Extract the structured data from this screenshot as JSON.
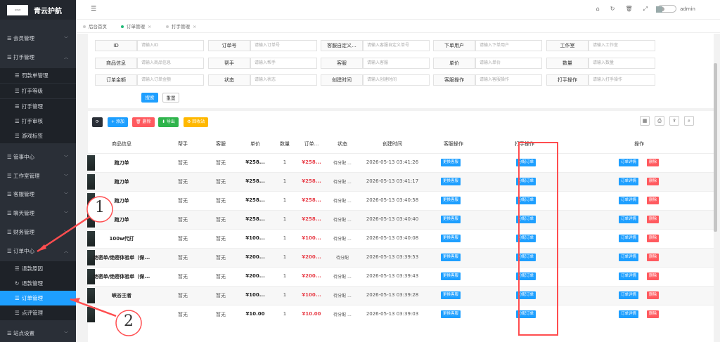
{
  "app": {
    "title": "青云护航",
    "logo_text": "LOGO"
  },
  "sidebar": {
    "items": [
      {
        "label": "会员管理",
        "icon": "list-icon",
        "type": "group",
        "expanded": false
      },
      {
        "label": "打手管理",
        "icon": "list-icon",
        "type": "group",
        "expanded": true
      },
      {
        "label": "罚款单管理",
        "icon": "list-icon",
        "type": "sub"
      },
      {
        "label": "打手等级",
        "icon": "list-icon",
        "type": "sub"
      },
      {
        "label": "打手管理",
        "icon": "list-icon",
        "type": "sub"
      },
      {
        "label": "打手审核",
        "icon": "list-icon",
        "type": "sub"
      },
      {
        "label": "游戏标签",
        "icon": "list-icon",
        "type": "sub"
      },
      {
        "label": "管事中心",
        "icon": "list-icon",
        "type": "group",
        "expanded": false
      },
      {
        "label": "工作室管理",
        "icon": "list-icon",
        "type": "group",
        "expanded": false
      },
      {
        "label": "客服管理",
        "icon": "list-icon",
        "type": "group",
        "expanded": false
      },
      {
        "label": "聊天管理",
        "icon": "list-icon",
        "type": "group",
        "expanded": false
      },
      {
        "label": "财务管理",
        "icon": "list-icon",
        "type": "group",
        "expanded": false
      },
      {
        "label": "订单中心",
        "icon": "list-icon",
        "type": "group",
        "expanded": true
      },
      {
        "label": "退款原因",
        "icon": "list-icon",
        "type": "sub"
      },
      {
        "label": "退款管理",
        "icon": "refresh-icon",
        "type": "sub"
      },
      {
        "label": "订单管理",
        "icon": "list-icon",
        "type": "sub",
        "active": true
      },
      {
        "label": "点评管理",
        "icon": "list-icon",
        "type": "sub"
      },
      {
        "label": "站点设置",
        "icon": "list-icon",
        "type": "group",
        "expanded": false
      }
    ]
  },
  "header": {
    "icons": [
      "home-icon",
      "refresh-icon",
      "trash-icon",
      "fullscreen-icon",
      "theme-toggle",
      "avatar"
    ],
    "user": "admin"
  },
  "tabs": [
    {
      "label": "后台首页",
      "active": false,
      "closable": false
    },
    {
      "label": "订单管理",
      "active": true,
      "closable": true
    },
    {
      "label": "打手管理",
      "active": false,
      "closable": true
    }
  ],
  "filters": [
    {
      "label": "ID",
      "placeholder": "请输入ID"
    },
    {
      "label": "订单号",
      "placeholder": "请输入订单号"
    },
    {
      "label": "客服自定义...",
      "placeholder": "请输入客服自定义单号"
    },
    {
      "label": "下单用户",
      "placeholder": "请输入下单用户"
    },
    {
      "label": "工作室",
      "placeholder": "请输入工作室"
    },
    {
      "label": "商品信息",
      "placeholder": "请输入商品信息"
    },
    {
      "label": "帮手",
      "placeholder": "请输入帮手"
    },
    {
      "label": "客服",
      "placeholder": "请输入客服"
    },
    {
      "label": "单价",
      "placeholder": "请输入单价"
    },
    {
      "label": "数量",
      "placeholder": "请输入数量"
    },
    {
      "label": "订单金额",
      "placeholder": "请输入订单金额"
    },
    {
      "label": "状态",
      "placeholder": "请输入状态"
    },
    {
      "label": "创建时间",
      "placeholder": "请输入创建时间"
    },
    {
      "label": "客服操作",
      "placeholder": "请输入客服操作"
    },
    {
      "label": "打手操作",
      "placeholder": "请输入打手操作"
    }
  ],
  "search_button": "搜索",
  "reset_button": "重置",
  "toolbar": {
    "refresh": "⟳",
    "add": "+ 添加",
    "delete": "🗑 删除",
    "export": "⬇ 导出",
    "recycle": "♻ 回收站"
  },
  "toolbar_right_icons": [
    "columns-icon",
    "print-icon",
    "export-icon",
    "search-icon"
  ],
  "table": {
    "columns": [
      "商品信息",
      "帮手",
      "客服",
      "单价",
      "数量",
      "订单...",
      "状态",
      "创建时间",
      "客服操作",
      "打手操作",
      "操作"
    ],
    "rows": [
      {
        "name": "跑刀单",
        "helper": "暂无",
        "service": "暂无",
        "price": "¥258...",
        "qty": "1",
        "amount": "¥258...",
        "status": "待分配 ...",
        "time": "2026-05-13 03:41:26"
      },
      {
        "name": "跑刀单",
        "helper": "暂无",
        "service": "暂无",
        "price": "¥258...",
        "qty": "1",
        "amount": "¥258...",
        "status": "待分配 ...",
        "time": "2026-05-13 03:41:17"
      },
      {
        "name": "跑刀单",
        "helper": "暂无",
        "service": "暂无",
        "price": "¥258...",
        "qty": "1",
        "amount": "¥258...",
        "status": "待分配 ...",
        "time": "2026-05-13 03:40:58"
      },
      {
        "name": "跑刀单",
        "helper": "暂无",
        "service": "暂无",
        "price": "¥258...",
        "qty": "1",
        "amount": "¥258...",
        "status": "待分配 ...",
        "time": "2026-05-13 03:40:40"
      },
      {
        "name": "100w代打",
        "helper": "暂无",
        "service": "暂无",
        "price": "¥100...",
        "qty": "1",
        "amount": "¥100...",
        "status": "待分配 ...",
        "time": "2026-05-13 03:40:08"
      },
      {
        "name": "绝密单/绝密体验单（保...",
        "helper": "暂无",
        "service": "暂无",
        "price": "¥200...",
        "qty": "1",
        "amount": "¥200...",
        "status": "待分配",
        "time": "2026-05-13 03:39:53"
      },
      {
        "name": "绝密单/绝密体验单（保...",
        "helper": "暂无",
        "service": "暂无",
        "price": "¥200...",
        "qty": "1",
        "amount": "¥200...",
        "status": "待分配 ...",
        "time": "2026-05-13 03:39:43"
      },
      {
        "name": "峡谷王者",
        "helper": "暂无",
        "service": "暂无",
        "price": "¥100...",
        "qty": "1",
        "amount": "¥100...",
        "status": "待分配 ...",
        "time": "2026-05-13 03:39:28"
      },
      {
        "name": "",
        "helper": "暂无",
        "service": "暂无",
        "price": "¥10.00",
        "qty": "1",
        "amount": "¥10.00",
        "status": "待分配 ...",
        "time": "2026-05-13 03:39:03"
      }
    ],
    "actions": {
      "change_service": "更换客服",
      "assign_order": "分配订单",
      "detail": "订单详情",
      "delete": "删除"
    }
  },
  "annotations": [
    {
      "number": "1"
    },
    {
      "number": "2"
    }
  ],
  "colors": {
    "sidebar_bg": "#2a2f37",
    "active_blue": "#1e9fff",
    "amount_red": "#e8414b",
    "highlight_red": "#ff4d4f",
    "add_green": "#2fb44c",
    "recycle_orange": "#ffb800",
    "delete_pink": "#ff5a5f"
  }
}
